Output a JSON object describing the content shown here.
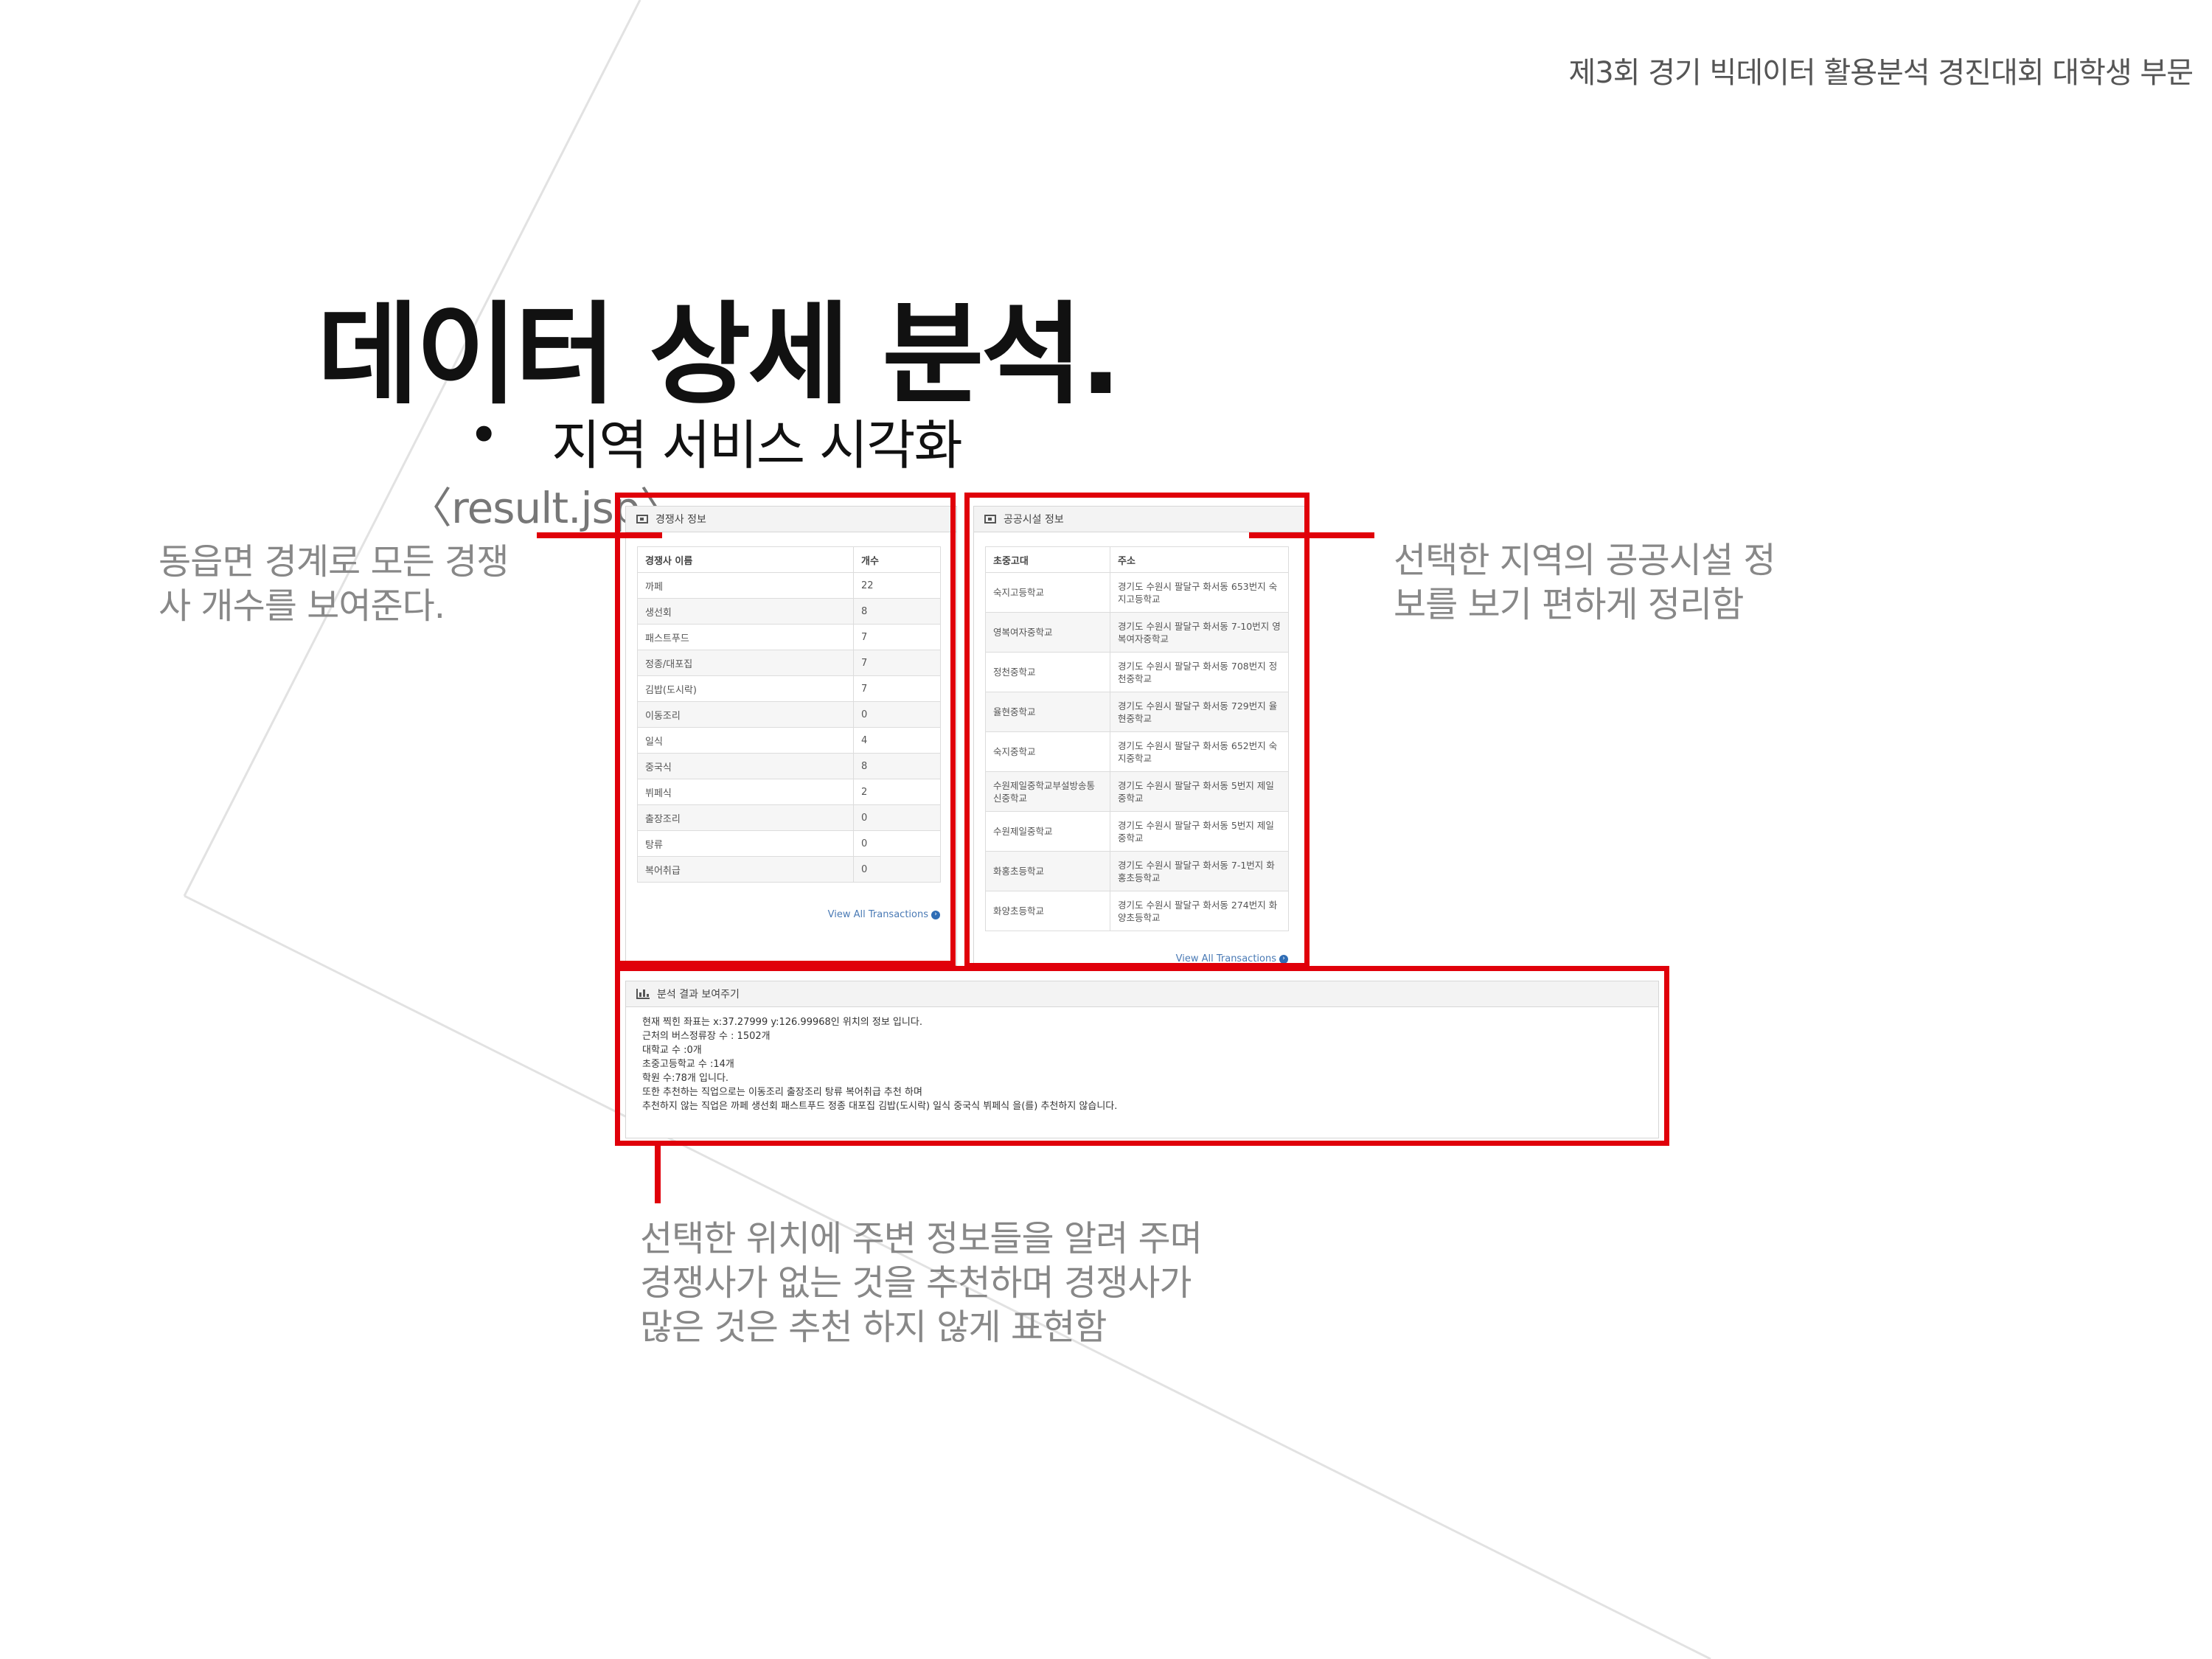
{
  "header": {
    "title": "제3회 경기 빅데이터 활용분석 경진대회 대학생 부문"
  },
  "slide": {
    "title": "데이터 상세 분석.",
    "bullet": "•",
    "subtitle": "지역 서비스 시각화",
    "file_label": "〈result.jsp〉"
  },
  "notes": {
    "left": "동읍면 경계로 모든 경쟁\n사 개수를 보여준다.",
    "right": "선택한 지역의 공공시설 정\n보를 보기 편하게 정리함",
    "bottom": "선택한 위치에 주변 정보들을 알려 주며\n경쟁사가 없는 것을 추천하며 경쟁사가\n많은 것은 추천 하지 않게 표현함"
  },
  "competitor_panel": {
    "title": "경쟁사 정보",
    "columns": [
      "경쟁사 이름",
      "개수"
    ],
    "rows": [
      [
        "까페",
        "22"
      ],
      [
        "생선회",
        "8"
      ],
      [
        "패스트푸드",
        "7"
      ],
      [
        "정종/대포집",
        "7"
      ],
      [
        "김밥(도시락)",
        "7"
      ],
      [
        "이동조리",
        "0"
      ],
      [
        "일식",
        "4"
      ],
      [
        "중국식",
        "8"
      ],
      [
        "뷔페식",
        "2"
      ],
      [
        "출장조리",
        "0"
      ],
      [
        "탕류",
        "0"
      ],
      [
        "복어취급",
        "0"
      ]
    ],
    "link": "View All Transactions"
  },
  "facility_panel": {
    "title": "공공시설 정보",
    "columns": [
      "초중고대",
      "주소"
    ],
    "rows": [
      [
        "숙지고등학교",
        "경기도 수원시 팔달구 화서동 653번지 숙지고등학교"
      ],
      [
        "영복여자중학교",
        "경기도 수원시 팔달구 화서동 7-10번지 영복여자중학교"
      ],
      [
        "정천중학교",
        "경기도 수원시 팔달구 화서동 708번지 정천중학교"
      ],
      [
        "율현중학교",
        "경기도 수원시 팔달구 화서동 729번지 율현중학교"
      ],
      [
        "숙지중학교",
        "경기도 수원시 팔달구 화서동 652번지 숙지중학교"
      ],
      [
        "수원제일중학교부설방송통신중학교",
        "경기도 수원시 팔달구 화서동 5번지 제일중학교"
      ],
      [
        "수원제일중학교",
        "경기도 수원시 팔달구 화서동 5번지 제일중학교"
      ],
      [
        "화홍초등학교",
        "경기도 수원시 팔달구 화서동 7-1번지 화홍초등학교"
      ],
      [
        "화양초등학교",
        "경기도 수원시 팔달구 화서동 274번지 화양초등학교"
      ]
    ],
    "link": "View All Transactions"
  },
  "analysis_panel": {
    "title": "분석 결과 보여주기",
    "lines": [
      "현재 찍힌 좌표는 x:37.27999 y:126.99968인 위치의 정보 입니다.",
      "근처의 버스정류장 수 : 1502개",
      "대학교 수 :0개",
      "초중고등학교 수 :14개",
      "학원 수:78개 입니다.",
      "또한 추천하는 직업으로는 이동조리 출장조리 탕류 복어취급 추천 하며",
      "추천하지 않는 직업은 까페 생선회 패스트푸드 정종 대포집 김밥(도시락) 일식 중국식 뷔페식 을(를) 추천하지 않습니다."
    ]
  },
  "colors": {
    "highlight": "#e0000a",
    "note_text": "#888888",
    "link": "#4a7ab5"
  }
}
